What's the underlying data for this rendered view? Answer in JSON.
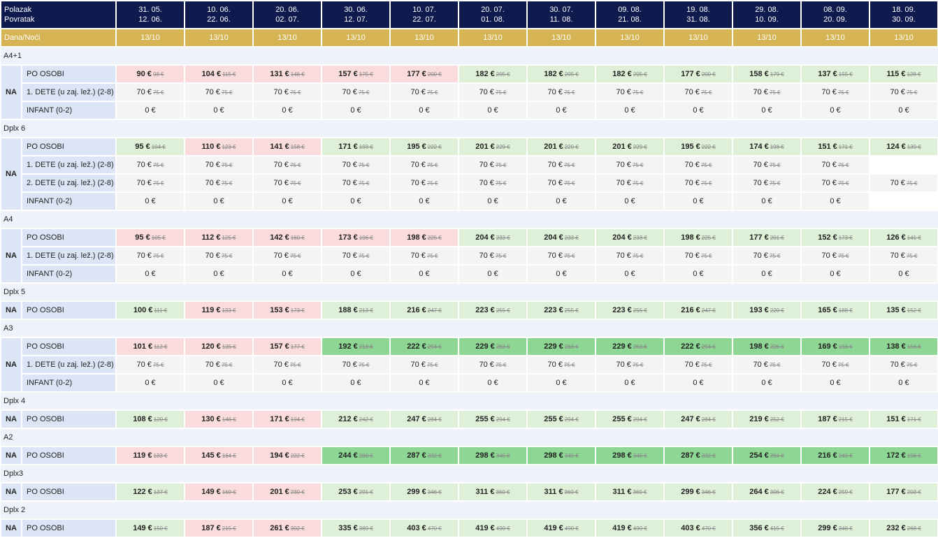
{
  "header": {
    "depart_label": "Polazak",
    "return_label": "Povratak",
    "nights_label": "Dana/Noći",
    "nights": "13/10",
    "dates": [
      {
        "dep": "31. 05.",
        "ret": "12. 06."
      },
      {
        "dep": "10. 06.",
        "ret": "22. 06."
      },
      {
        "dep": "20. 06.",
        "ret": "02. 07."
      },
      {
        "dep": "30. 06.",
        "ret": "12. 07."
      },
      {
        "dep": "10. 07.",
        "ret": "22. 07."
      },
      {
        "dep": "20. 07.",
        "ret": "01. 08."
      },
      {
        "dep": "30. 07.",
        "ret": "11. 08."
      },
      {
        "dep": "09. 08.",
        "ret": "21. 08."
      },
      {
        "dep": "19. 08.",
        "ret": "31. 08."
      },
      {
        "dep": "29. 08.",
        "ret": "10. 09."
      },
      {
        "dep": "08. 09.",
        "ret": "20. 09."
      },
      {
        "dep": "18. 09.",
        "ret": "30. 09."
      }
    ]
  },
  "colors": {
    "header_bg": "#0f1a4f",
    "nights_bg": "#d6b454",
    "red": "#fbdcdc",
    "light_green": "#dff0d8",
    "green": "#8ed694",
    "gray": "#f4f4f4"
  },
  "groups": [
    {
      "name": "A4+1",
      "board": "NA",
      "rows": [
        {
          "label": "PO OSOBI",
          "cells": [
            {
              "p": "90 €",
              "o": "98 €",
              "c": "red"
            },
            {
              "p": "104 €",
              "o": "115 €",
              "c": "red"
            },
            {
              "p": "131 €",
              "o": "146 €",
              "c": "red"
            },
            {
              "p": "157 €",
              "o": "175 €",
              "c": "red"
            },
            {
              "p": "177 €",
              "o": "200 €",
              "c": "red"
            },
            {
              "p": "182 €",
              "o": "205 €",
              "c": "lg"
            },
            {
              "p": "182 €",
              "o": "205 €",
              "c": "lg"
            },
            {
              "p": "182 €",
              "o": "205 €",
              "c": "lg"
            },
            {
              "p": "177 €",
              "o": "200 €",
              "c": "lg"
            },
            {
              "p": "158 €",
              "o": "179 €",
              "c": "lg"
            },
            {
              "p": "137 €",
              "o": "155 €",
              "c": "lg"
            },
            {
              "p": "115 €",
              "o": "128 €",
              "c": "lg"
            }
          ]
        },
        {
          "label": "1. DETE (u zaj. lež.) (2-8)",
          "cells": "child"
        },
        {
          "label": "INFANT (0-2)",
          "cells": "infant"
        }
      ]
    },
    {
      "name": "Dplx 6",
      "board": "NA",
      "rows": [
        {
          "label": "PO OSOBI",
          "cells": [
            {
              "p": "95 €",
              "o": "104 €",
              "c": "lg"
            },
            {
              "p": "110 €",
              "o": "123 €",
              "c": "red"
            },
            {
              "p": "141 €",
              "o": "158 €",
              "c": "red"
            },
            {
              "p": "171 €",
              "o": "193 €",
              "c": "lg"
            },
            {
              "p": "195 €",
              "o": "222 €",
              "c": "lg"
            },
            {
              "p": "201 €",
              "o": "229 €",
              "c": "lg"
            },
            {
              "p": "201 €",
              "o": "229 €",
              "c": "lg"
            },
            {
              "p": "201 €",
              "o": "229 €",
              "c": "lg"
            },
            {
              "p": "195 €",
              "o": "222 €",
              "c": "lg"
            },
            {
              "p": "174 €",
              "o": "198 €",
              "c": "lg"
            },
            {
              "p": "151 €",
              "o": "171 €",
              "c": "lg"
            },
            {
              "p": "124 €",
              "o": "139 €",
              "c": "lg"
            }
          ]
        },
        {
          "label": "1. DETE (u zaj. lež.) (2-8)",
          "cells": "child11"
        },
        {
          "label": "2. DETE (u zaj. lež.) (2-8)",
          "cells": "child"
        },
        {
          "label": "INFANT (0-2)",
          "cells": "infant11"
        }
      ]
    },
    {
      "name": "A4",
      "board": "NA",
      "rows": [
        {
          "label": "PO OSOBI",
          "cells": [
            {
              "p": "95 €",
              "o": "105 €",
              "c": "red"
            },
            {
              "p": "112 €",
              "o": "125 €",
              "c": "red"
            },
            {
              "p": "142 €",
              "o": "160 €",
              "c": "red"
            },
            {
              "p": "173 €",
              "o": "196 €",
              "c": "red"
            },
            {
              "p": "198 €",
              "o": "225 €",
              "c": "red"
            },
            {
              "p": "204 €",
              "o": "233 €",
              "c": "lg"
            },
            {
              "p": "204 €",
              "o": "233 €",
              "c": "lg"
            },
            {
              "p": "204 €",
              "o": "233 €",
              "c": "lg"
            },
            {
              "p": "198 €",
              "o": "225 €",
              "c": "lg"
            },
            {
              "p": "177 €",
              "o": "201 €",
              "c": "lg"
            },
            {
              "p": "152 €",
              "o": "173 €",
              "c": "lg"
            },
            {
              "p": "126 €",
              "o": "141 €",
              "c": "lg"
            }
          ]
        },
        {
          "label": "1. DETE (u zaj. lež.) (2-8)",
          "cells": "child"
        },
        {
          "label": "INFANT (0-2)",
          "cells": "infant"
        }
      ]
    },
    {
      "name": "Dplx 5",
      "board": "NA",
      "rows": [
        {
          "label": "PO OSOBI",
          "cells": [
            {
              "p": "100 €",
              "o": "111 €",
              "c": "lg"
            },
            {
              "p": "119 €",
              "o": "133 €",
              "c": "red"
            },
            {
              "p": "153 €",
              "o": "173 €",
              "c": "red"
            },
            {
              "p": "188 €",
              "o": "213 €",
              "c": "lg"
            },
            {
              "p": "216 €",
              "o": "247 €",
              "c": "lg"
            },
            {
              "p": "223 €",
              "o": "255 €",
              "c": "lg"
            },
            {
              "p": "223 €",
              "o": "255 €",
              "c": "lg"
            },
            {
              "p": "223 €",
              "o": "255 €",
              "c": "lg"
            },
            {
              "p": "216 €",
              "o": "247 €",
              "c": "lg"
            },
            {
              "p": "193 €",
              "o": "220 €",
              "c": "lg"
            },
            {
              "p": "165 €",
              "o": "188 €",
              "c": "lg"
            },
            {
              "p": "135 €",
              "o": "152 €",
              "c": "lg"
            }
          ]
        }
      ]
    },
    {
      "name": "A3",
      "board": "NA",
      "rows": [
        {
          "label": "PO OSOBI",
          "cells": [
            {
              "p": "101 €",
              "o": "112 €",
              "c": "red"
            },
            {
              "p": "120 €",
              "o": "135 €",
              "c": "red"
            },
            {
              "p": "157 €",
              "o": "177 €",
              "c": "red"
            },
            {
              "p": "192 €",
              "o": "218 €",
              "c": "dg"
            },
            {
              "p": "222 €",
              "o": "254 €",
              "c": "dg"
            },
            {
              "p": "229 €",
              "o": "263 €",
              "c": "dg"
            },
            {
              "p": "229 €",
              "o": "263 €",
              "c": "dg"
            },
            {
              "p": "229 €",
              "o": "263 €",
              "c": "dg"
            },
            {
              "p": "222 €",
              "o": "254 €",
              "c": "dg"
            },
            {
              "p": "198 €",
              "o": "226 €",
              "c": "dg"
            },
            {
              "p": "169 €",
              "o": "193 €",
              "c": "dg"
            },
            {
              "p": "138 €",
              "o": "156 €",
              "c": "dg"
            }
          ]
        },
        {
          "label": "1. DETE (u zaj. lež.) (2-8)",
          "cells": "child"
        },
        {
          "label": "INFANT (0-2)",
          "cells": "infant"
        }
      ]
    },
    {
      "name": "Dplx 4",
      "board": "NA",
      "rows": [
        {
          "label": "PO OSOBI",
          "cells": [
            {
              "p": "108 €",
              "o": "120 €",
              "c": "lg"
            },
            {
              "p": "130 €",
              "o": "146 €",
              "c": "red"
            },
            {
              "p": "171 €",
              "o": "194 €",
              "c": "red"
            },
            {
              "p": "212 €",
              "o": "242 €",
              "c": "lg"
            },
            {
              "p": "247 €",
              "o": "284 €",
              "c": "lg"
            },
            {
              "p": "255 €",
              "o": "294 €",
              "c": "lg"
            },
            {
              "p": "255 €",
              "o": "294 €",
              "c": "lg"
            },
            {
              "p": "255 €",
              "o": "294 €",
              "c": "lg"
            },
            {
              "p": "247 €",
              "o": "284 €",
              "c": "lg"
            },
            {
              "p": "219 €",
              "o": "252 €",
              "c": "lg"
            },
            {
              "p": "187 €",
              "o": "215 €",
              "c": "lg"
            },
            {
              "p": "151 €",
              "o": "171 €",
              "c": "lg"
            }
          ]
        }
      ]
    },
    {
      "name": "A2",
      "board": "NA",
      "rows": [
        {
          "label": "PO OSOBI",
          "cells": [
            {
              "p": "119 €",
              "o": "133 €",
              "c": "red"
            },
            {
              "p": "145 €",
              "o": "164 €",
              "c": "red"
            },
            {
              "p": "194 €",
              "o": "222 €",
              "c": "red"
            },
            {
              "p": "244 €",
              "o": "280 €",
              "c": "dg"
            },
            {
              "p": "287 €",
              "o": "332 €",
              "c": "dg"
            },
            {
              "p": "298 €",
              "o": "345 €",
              "c": "dg"
            },
            {
              "p": "298 €",
              "o": "345 €",
              "c": "dg"
            },
            {
              "p": "298 €",
              "o": "345 €",
              "c": "dg"
            },
            {
              "p": "287 €",
              "o": "332 €",
              "c": "dg"
            },
            {
              "p": "254 €",
              "o": "294 €",
              "c": "dg"
            },
            {
              "p": "216 €",
              "o": "249 €",
              "c": "dg"
            },
            {
              "p": "172 €",
              "o": "196 €",
              "c": "dg"
            }
          ]
        }
      ]
    },
    {
      "name": "Dplx3",
      "board": "NA",
      "rows": [
        {
          "label": "PO OSOBI",
          "cells": [
            {
              "p": "122 €",
              "o": "137 €",
              "c": "lg"
            },
            {
              "p": "149 €",
              "o": "169 €",
              "c": "red"
            },
            {
              "p": "201 €",
              "o": "230 €",
              "c": "red"
            },
            {
              "p": "253 €",
              "o": "291 €",
              "c": "lg"
            },
            {
              "p": "299 €",
              "o": "346 €",
              "c": "lg"
            },
            {
              "p": "311 €",
              "o": "360 €",
              "c": "lg"
            },
            {
              "p": "311 €",
              "o": "360 €",
              "c": "lg"
            },
            {
              "p": "311 €",
              "o": "360 €",
              "c": "lg"
            },
            {
              "p": "299 €",
              "o": "346 €",
              "c": "lg"
            },
            {
              "p": "264 €",
              "o": "306 €",
              "c": "lg"
            },
            {
              "p": "224 €",
              "o": "259 €",
              "c": "lg"
            },
            {
              "p": "177 €",
              "o": "203 €",
              "c": "lg"
            }
          ]
        }
      ]
    },
    {
      "name": "Dplx 2",
      "board": "NA",
      "rows": [
        {
          "label": "PO OSOBI",
          "cells": [
            {
              "p": "149 €",
              "o": "150 €",
              "c": "lg"
            },
            {
              "p": "187 €",
              "o": "215 €",
              "c": "red"
            },
            {
              "p": "261 €",
              "o": "302 €",
              "c": "red"
            },
            {
              "p": "335 €",
              "o": "389 €",
              "c": "lg"
            },
            {
              "p": "403 €",
              "o": "470 €",
              "c": "lg"
            },
            {
              "p": "419 €",
              "o": "490 €",
              "c": "lg"
            },
            {
              "p": "419 €",
              "o": "490 €",
              "c": "lg"
            },
            {
              "p": "419 €",
              "o": "490 €",
              "c": "lg"
            },
            {
              "p": "403 €",
              "o": "470 €",
              "c": "lg"
            },
            {
              "p": "356 €",
              "o": "415 €",
              "c": "lg"
            },
            {
              "p": "299 €",
              "o": "348 €",
              "c": "lg"
            },
            {
              "p": "232 €",
              "o": "268 €",
              "c": "lg"
            }
          ]
        }
      ]
    }
  ],
  "child_price": {
    "p": "70 €",
    "o": "75 €"
  },
  "infant_price": "0 €"
}
